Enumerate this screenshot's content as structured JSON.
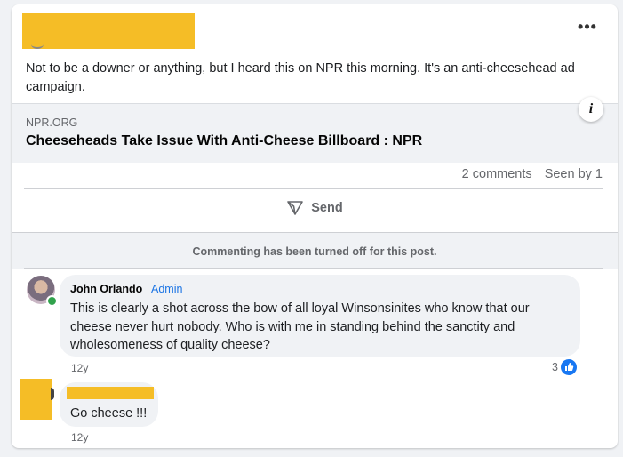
{
  "post": {
    "text": "Not to be a downer or anything, but I heard this on NPR this morning.  It's an anti-cheesehead ad campaign.",
    "more_icon": "more-horizontal-icon",
    "more_label": "•••"
  },
  "link_preview": {
    "domain": "NPR.ORG",
    "title": "Cheeseheads Take Issue With Anti-Cheese Billboard : NPR",
    "info_label": "i"
  },
  "stats": {
    "comments": "2 comments",
    "seen": "Seen by 1"
  },
  "actions": {
    "send_label": "Send"
  },
  "commenting_notice": "Commenting has been turned off for this post.",
  "comments": [
    {
      "author": "John Orlando",
      "badge": "Admin",
      "text": "This is clearly a shot across the bow of all loyal Winsonsinites who know that our cheese never hurt nobody. Who is with me in standing behind the sanctity and wholesomeness of quality cheese?",
      "time": "12y",
      "reaction_count": "3"
    },
    {
      "text": "Go cheese !!!",
      "time": "12y"
    }
  ],
  "colors": {
    "redaction": "#f5bd26",
    "accent": "#1877f2",
    "online": "#31a24c"
  }
}
